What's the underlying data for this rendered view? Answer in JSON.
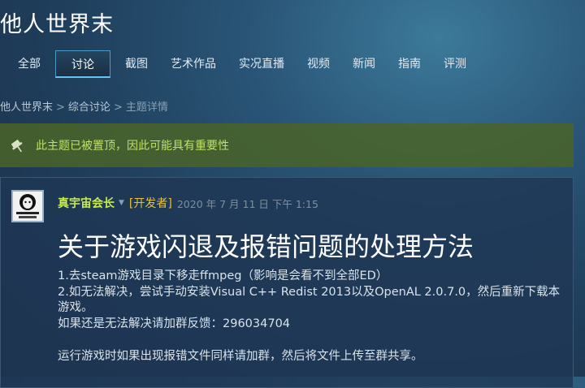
{
  "hub": {
    "title": "他人世界末"
  },
  "tabs": [
    {
      "label": "全部"
    },
    {
      "label": "讨论",
      "active": true
    },
    {
      "label": "截图"
    },
    {
      "label": "艺术作品"
    },
    {
      "label": "实况直播"
    },
    {
      "label": "视频"
    },
    {
      "label": "新闻"
    },
    {
      "label": "指南"
    },
    {
      "label": "评测"
    }
  ],
  "breadcrumb": {
    "game": "他人世界末",
    "forum": "综合讨论",
    "current": "主题详情"
  },
  "sticky_notice": {
    "icon": "pin-icon",
    "text": "此主题已被置顶，因此可能具有重要性"
  },
  "post": {
    "author": "真宇宙会长",
    "dev_tag": "[开发者]",
    "date": "2020 年 7 月 11 日 下午 1:15",
    "title": "关于游戏闪退及报错问题的处理方法",
    "lines": [
      "1.去steam游戏目录下移走ffmpeg（影响是会看不到全部ED）",
      "2.如无法解决，尝试手动安装Visual C++ Redist 2013以及OpenAL 2.0.7.0，然后重新下载本游戏。",
      "如果还是无法解决请加群反馈：296034704",
      "运行游戏时如果出现报错文件同样请加群，然后将文件上传至群共享。"
    ]
  },
  "colors": {
    "author": "#c6ec4d",
    "dev_tag": "#e8c233",
    "sticky_text": "#bfe06a",
    "active_tab_border": "#67c1f5"
  }
}
